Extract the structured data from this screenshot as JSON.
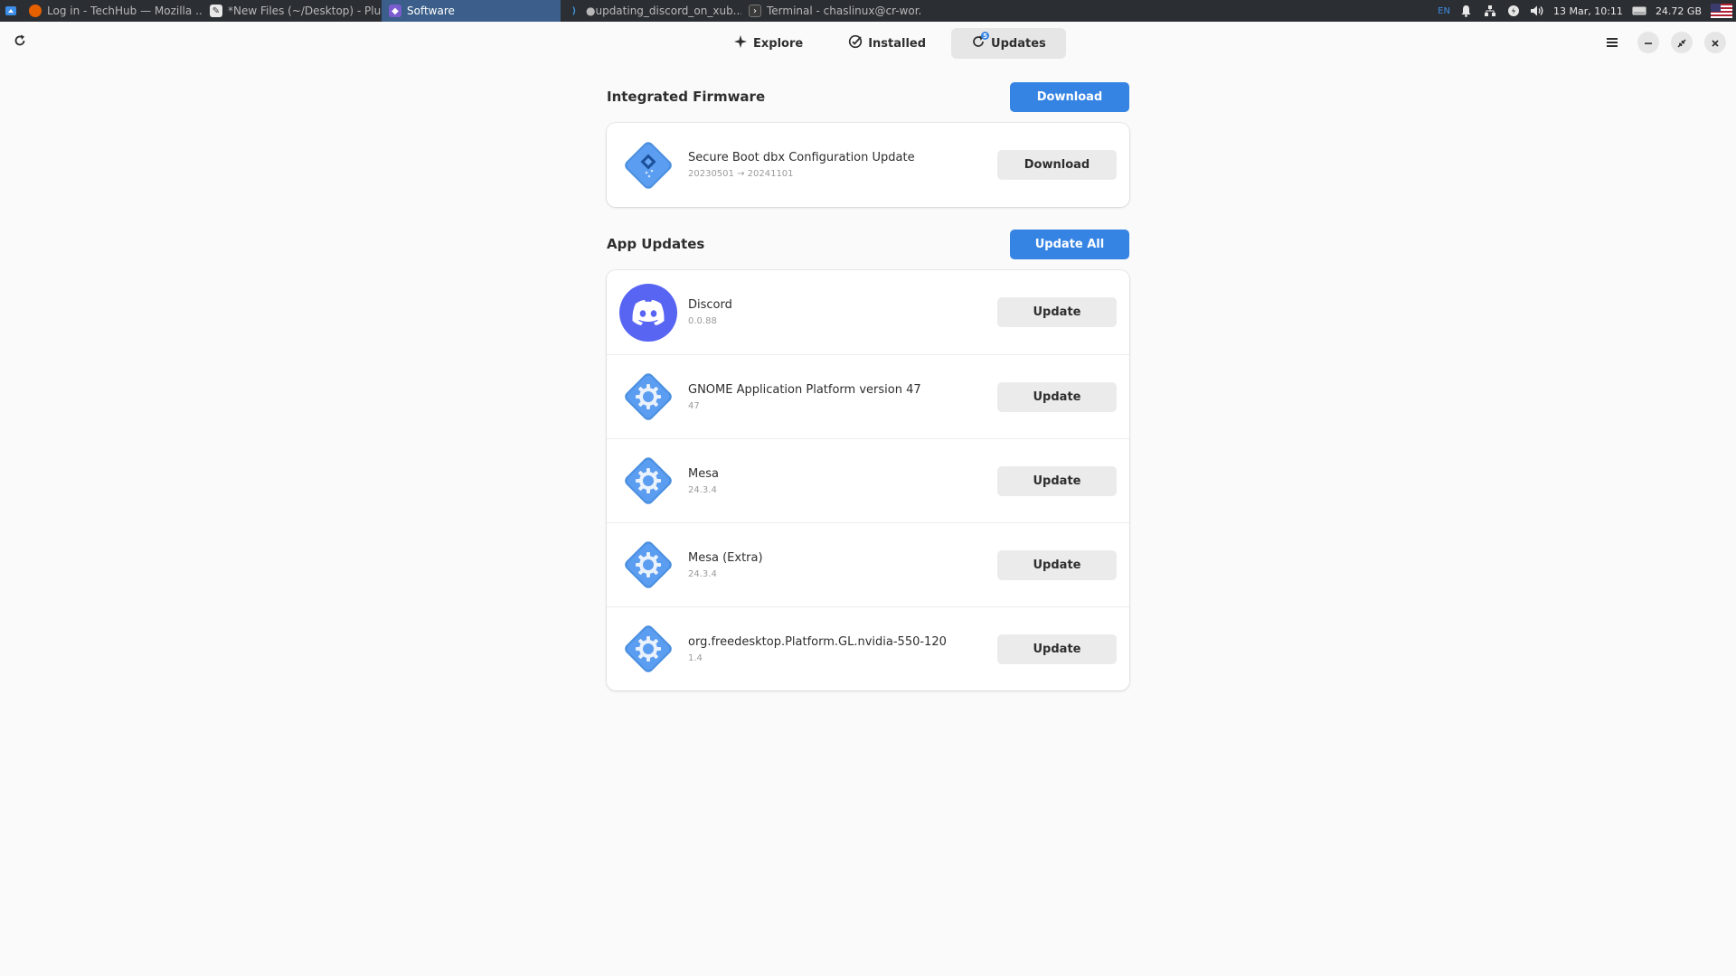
{
  "taskbar": {
    "tasks": [
      {
        "label": "Log in - TechHub — Mozilla ...",
        "icon": "firefox-icon"
      },
      {
        "label": "*New Files (~/Desktop) - Plu...",
        "icon": "text-editor-icon"
      },
      {
        "label": "Software",
        "icon": "software-icon"
      },
      {
        "label": "●updating_discord_on_xub...",
        "icon": "vscode-icon"
      },
      {
        "label": "Terminal - chaslinux@cr-wor...",
        "icon": "terminal-icon"
      }
    ],
    "keyboard_layout": "EN",
    "datetime": "13 Mar, 10:11",
    "disk_free": "24.72 GB"
  },
  "header": {
    "tabs": [
      {
        "label": "Explore",
        "icon": "explore-icon"
      },
      {
        "label": "Installed",
        "icon": "installed-check-icon"
      },
      {
        "label": "Updates",
        "icon": "updates-icon",
        "active": true,
        "badge": "5"
      }
    ]
  },
  "firmware": {
    "title": "Integrated Firmware",
    "header_button": "Download",
    "items": [
      {
        "name": "Secure Boot dbx Configuration Update",
        "version": "20230501 → 20241101",
        "button": "Download"
      }
    ]
  },
  "apps": {
    "title": "App Updates",
    "header_button": "Update All",
    "items": [
      {
        "name": "Discord",
        "version": "0.0.88",
        "button": "Update",
        "icon": "discord-icon"
      },
      {
        "name": "GNOME Application Platform version 47",
        "version": "47",
        "button": "Update",
        "icon": "package-gear-icon"
      },
      {
        "name": "Mesa",
        "version": "24.3.4",
        "button": "Update",
        "icon": "package-gear-icon"
      },
      {
        "name": "Mesa (Extra)",
        "version": "24.3.4",
        "button": "Update",
        "icon": "package-gear-icon"
      },
      {
        "name": "org.freedesktop.Platform.GL.nvidia-550-120",
        "version": "1.4",
        "button": "Update",
        "icon": "package-gear-icon"
      }
    ]
  },
  "colors": {
    "accent": "#3584e4",
    "discord": "#5865f2",
    "package_icon": "#4a8fe0"
  }
}
